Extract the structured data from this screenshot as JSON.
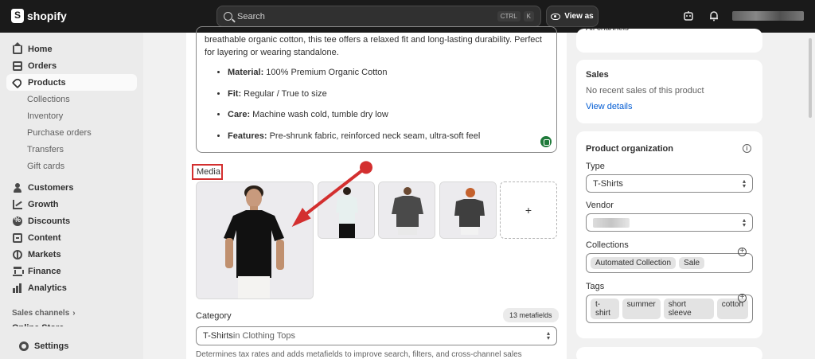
{
  "topbar": {
    "brand": "shopify",
    "search_placeholder": "Search",
    "shortcut_keys": [
      "CTRL",
      "K"
    ],
    "view_as_label": "View as"
  },
  "sidebar": {
    "items": [
      {
        "label": "Home",
        "icon": "home-icon"
      },
      {
        "label": "Orders",
        "icon": "orders-icon"
      },
      {
        "label": "Products",
        "icon": "tag-icon",
        "active": true
      }
    ],
    "product_subitems": [
      "Collections",
      "Inventory",
      "Purchase orders",
      "Transfers",
      "Gift cards"
    ],
    "more_items": [
      {
        "label": "Customers",
        "icon": "person-icon"
      },
      {
        "label": "Growth",
        "icon": "growth-icon"
      },
      {
        "label": "Discounts",
        "icon": "discount-icon"
      },
      {
        "label": "Content",
        "icon": "content-icon"
      },
      {
        "label": "Markets",
        "icon": "globe-icon"
      },
      {
        "label": "Finance",
        "icon": "bank-icon"
      },
      {
        "label": "Analytics",
        "icon": "bar-chart-icon"
      }
    ],
    "sales_channels_label": "Sales channels",
    "online_store_label": "Online Store",
    "settings_label": "Settings"
  },
  "description": {
    "text": "breathable organic cotton, this tee offers a relaxed fit and long-lasting durability. Perfect for layering or wearing standalone.",
    "bullets": [
      {
        "key": "Material:",
        "value": " 100% Premium Organic Cotton"
      },
      {
        "key": "Fit:",
        "value": " Regular / True to size"
      },
      {
        "key": "Care:",
        "value": " Machine wash cold, tumble dry low"
      },
      {
        "key": "Features:",
        "value": " Pre-shrunk fabric, reinforced neck seam, ultra-soft feel"
      }
    ]
  },
  "media": {
    "label": "Media",
    "add_symbol": "+"
  },
  "category": {
    "label": "Category",
    "metafields_badge": "13 metafields",
    "value_main": "T-Shirts",
    "value_suffix": " in Clothing Tops",
    "help_text": "Determines tax rates and adds metafields to improve search, filters, and cross-channel sales"
  },
  "top_card": {
    "partial_text": "All channels"
  },
  "sales_card": {
    "title": "Sales",
    "text": "No recent sales of this product",
    "link": "View details"
  },
  "organization": {
    "title": "Product organization",
    "type_label": "Type",
    "type_value": "T-Shirts",
    "vendor_label": "Vendor",
    "collections_label": "Collections",
    "collections": [
      "Automated Collection",
      "Sale"
    ],
    "tags_label": "Tags",
    "tags": [
      "t-shirt",
      "summer",
      "short sleeve",
      "cotton"
    ]
  },
  "colors": {
    "accent_link": "#005bd3",
    "annotation_red": "#d32f2f",
    "topbar_bg": "#1a1a1a"
  }
}
